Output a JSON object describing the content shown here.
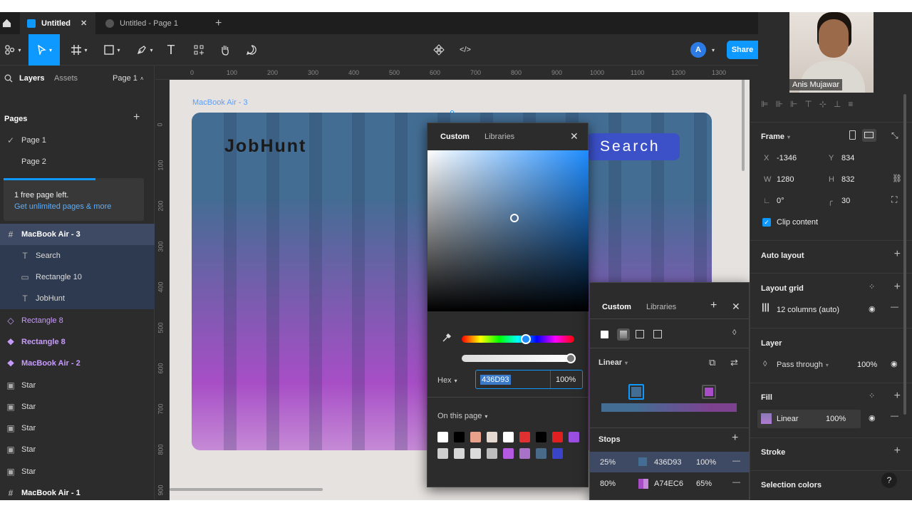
{
  "tabs": [
    {
      "label": "Untitled"
    },
    {
      "label": "Untitled - Page 1"
    }
  ],
  "toolbar": {
    "share_label": "Share",
    "avatar_letter": "A"
  },
  "left_panel": {
    "tab_layers": "Layers",
    "tab_assets": "Assets",
    "page_select": "Page 1",
    "pages_heading": "Pages",
    "pages": [
      {
        "label": "Page 1"
      },
      {
        "label": "Page 2"
      }
    ],
    "notice_title": "1 free page left.",
    "notice_link": "Get unlimited pages & more",
    "layers": [
      {
        "label": "MacBook Air - 3"
      },
      {
        "label": "Search"
      },
      {
        "label": "Rectangle 10"
      },
      {
        "label": "JobHunt"
      },
      {
        "label": "Rectangle 8"
      },
      {
        "label": "Rectangle 8"
      },
      {
        "label": "MacBook Air - 2"
      },
      {
        "label": "Star"
      },
      {
        "label": "Star"
      },
      {
        "label": "Star"
      },
      {
        "label": "Star"
      },
      {
        "label": "Star"
      },
      {
        "label": "MacBook Air - 1"
      }
    ]
  },
  "ruler": {
    "h": [
      "0",
      "100",
      "200",
      "300",
      "400",
      "500",
      "600",
      "700",
      "800",
      "900",
      "1000",
      "1100",
      "1200",
      "1300"
    ],
    "v": [
      "0",
      "100",
      "200",
      "300",
      "400",
      "500",
      "600",
      "700",
      "800",
      "900"
    ]
  },
  "canvas": {
    "frame_label": "MacBook Air - 3",
    "logo_text": "JobHunt",
    "search_text": "Search"
  },
  "color_picker": {
    "tab_custom": "Custom",
    "tab_libraries": "Libraries",
    "format": "Hex",
    "hex": "436D93",
    "opacity": "100%",
    "on_page": "On this page",
    "swatches": [
      "#ffffff",
      "#000000",
      "#e8a28b",
      "#e6d9cf",
      "#ffffff",
      "#e03030",
      "#000000",
      "#e02020",
      "#9b4fe0",
      "#cfcfcf",
      "#d7d7d7",
      "#dcdcdc",
      "#bdbdbd",
      "#b45ae0",
      "#a872c8",
      "#4a6a8a",
      "#3a44c8"
    ]
  },
  "fill_panel": {
    "tab_custom": "Custom",
    "tab_libraries": "Libraries",
    "type": "Linear",
    "stops_heading": "Stops",
    "stops": [
      {
        "pos": "25%",
        "hex": "436D93",
        "opacity": "100%",
        "color": "#436D93"
      },
      {
        "pos": "80%",
        "hex": "A74EC6",
        "opacity": "65%",
        "color": "#A74EC6"
      }
    ]
  },
  "right_panel": {
    "frame_heading": "Frame",
    "x_label": "X",
    "x": "-1346",
    "y_label": "Y",
    "y": "834",
    "w_label": "W",
    "w": "1280",
    "h_label": "H",
    "h": "832",
    "rotation": "0°",
    "radius": "30",
    "clip": "Clip content",
    "auto_layout": "Auto layout",
    "layout_grid": "Layout grid",
    "grid_value": "12 columns (auto)",
    "layer_heading": "Layer",
    "blend": "Pass through",
    "layer_opacity": "100%",
    "fill_heading": "Fill",
    "fill_type": "Linear",
    "fill_opacity": "100%",
    "stroke_heading": "Stroke",
    "selection_colors": "Selection colors"
  },
  "video": {
    "name": "Anis Mujawar"
  }
}
